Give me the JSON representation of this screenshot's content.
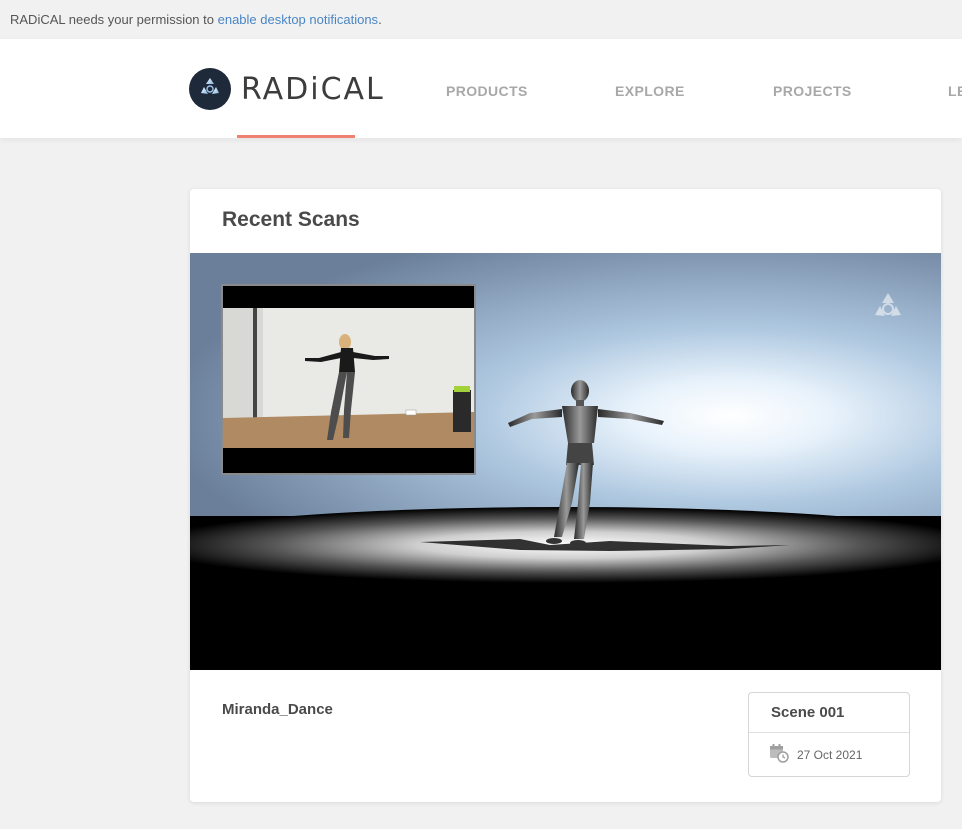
{
  "notification": {
    "prefix": "RADiCAL needs your permission to ",
    "link": "enable desktop notifications",
    "suffix": "."
  },
  "brand": {
    "name": "RADiCAL",
    "accent": "#f08070",
    "logo_icon": "radical-logo-icon"
  },
  "nav": {
    "items": [
      {
        "label": "PRODUCTS"
      },
      {
        "label": "EXPLORE"
      },
      {
        "label": "PROJECTS"
      },
      {
        "label": "LE"
      }
    ]
  },
  "recent": {
    "title": "Recent Scans",
    "scans": [
      {
        "name": "Miranda_Dance",
        "scene": "Scene 001",
        "date": "27 Oct 2021",
        "date_icon": "calendar-clock-icon",
        "watermark_icon": "radical-watermark-icon"
      }
    ]
  }
}
